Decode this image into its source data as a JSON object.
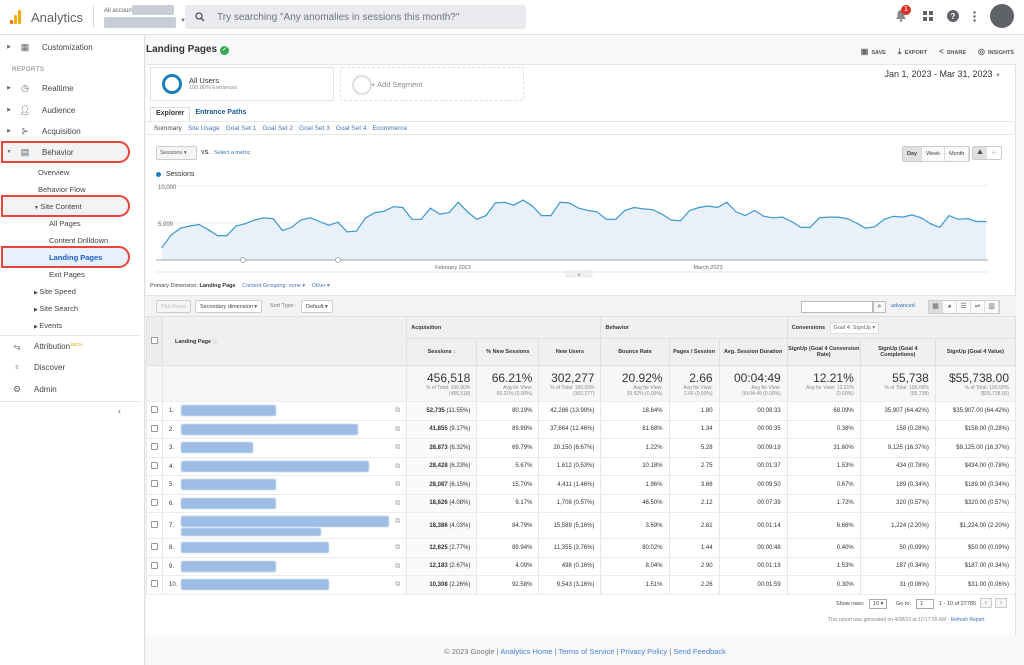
{
  "app": {
    "title": "Analytics",
    "all_accounts": "All accounts >",
    "search_placeholder": "Try searching \"Any anomalies in sessions this month?\"",
    "notification_count": "1"
  },
  "sidebar": {
    "customization": "Customization",
    "reports_label": "REPORTS",
    "items": [
      "Realtime",
      "Audience",
      "Acquisition",
      "Behavior"
    ],
    "behavior_sub": [
      "Overview",
      "Behavior Flow"
    ],
    "site_content": "Site Content",
    "site_content_sub": [
      "All Pages",
      "Content Drilldown",
      "Landing Pages",
      "Exit Pages"
    ],
    "more_sub": [
      "Site Speed",
      "Site Search",
      "Events"
    ],
    "attribution": "Attribution",
    "beta": "BETA",
    "discover": "Discover",
    "admin": "Admin"
  },
  "header": {
    "title": "Landing Pages",
    "save": "SAVE",
    "export": "EXPORT",
    "share": "SHARE",
    "insights": "INSIGHTS",
    "date_range": "Jan 1, 2023 - Mar 31, 2023"
  },
  "segments": {
    "name": "All Users",
    "sub": "100.00% Entrances",
    "add": "+ Add Segment"
  },
  "tabs": [
    "Explorer",
    "Entrance Paths"
  ],
  "subtabs": [
    "Summary",
    "Site Usage",
    "Goal Set 1",
    "Goal Set 2",
    "Goal Set 3",
    "Goal Set 4",
    "Ecommerce"
  ],
  "chart_controls": {
    "metric": "Sessions",
    "vs": "VS.",
    "select_metric": "Select a metric",
    "granularity": [
      "Day",
      "Week",
      "Month"
    ]
  },
  "chart_data": {
    "type": "area",
    "series": [
      {
        "name": "Sessions",
        "color": "#1a7fbf",
        "values": [
          1700,
          3400,
          4300,
          4600,
          4800,
          4100,
          3300,
          3300,
          4600,
          4900,
          5400,
          5700,
          5600,
          4000,
          4400,
          5400,
          5700,
          5200,
          4700,
          5100,
          3800,
          3900,
          5700,
          6400,
          6600,
          7200,
          7100,
          5500,
          5500,
          7000,
          6200,
          6400,
          7800,
          6500,
          5500,
          6000,
          7700,
          7800,
          7400,
          8100,
          7300,
          6000,
          6000,
          7800,
          7700,
          7000,
          6700,
          6500,
          5500,
          5500,
          6700,
          7100,
          6900,
          6800,
          6200,
          5400,
          5300,
          6700,
          7100,
          7300,
          7100,
          7800,
          6500,
          6000,
          6700,
          5900,
          5700,
          5800,
          5200,
          4400,
          4400,
          5700,
          5800,
          5800,
          5600,
          5000,
          4300,
          4500,
          5500,
          5900,
          5800,
          6100,
          5700,
          4900,
          4400,
          6000,
          5500,
          5600,
          5200,
          5200
        ]
      }
    ],
    "yticks": [
      "10,000",
      "5,000"
    ],
    "ylim": [
      0,
      11000
    ],
    "xlabels": [
      "February 2023",
      "March 2023"
    ],
    "grid": true
  },
  "dimension": {
    "primary_label": "Primary Dimension:",
    "primary": "Landing Page",
    "grouping": "Content Grouping: none ▾",
    "other": "Other ▾"
  },
  "toolbar": {
    "plot_rows": "Plot Rows",
    "secondary": "Secondary dimension ▾",
    "sort_type": "Sort Type:",
    "sort_value": "Default ▾",
    "advanced": "advanced"
  },
  "table": {
    "landing_col": "Landing Page",
    "groups": [
      "Acquisition",
      "Behavior",
      "Conversions"
    ],
    "goal_select": "Goal 4: SignUp ▾",
    "columns": [
      "Sessions",
      "% New Sessions",
      "New Users",
      "Bounce Rate",
      "Pages / Session",
      "Avg. Session Duration",
      "SignUp (Goal 4 Conversion Rate)",
      "SignUp (Goal 4 Completions)",
      "SignUp (Goal 4 Value)"
    ],
    "totals": [
      {
        "v": "456,518",
        "s1": "% of Total: 100.00%",
        "s2": "(456,518)"
      },
      {
        "v": "66.21%",
        "s1": "Avg for View:",
        "s2": "66.21% (0.00%)"
      },
      {
        "v": "302,277",
        "s1": "% of Total: 100.00%",
        "s2": "(302,277)"
      },
      {
        "v": "20.92%",
        "s1": "Avg for View:",
        "s2": "20.92% (0.00%)"
      },
      {
        "v": "2.66",
        "s1": "Avg for View:",
        "s2": "2.66 (0.00%)"
      },
      {
        "v": "00:04:49",
        "s1": "Avg for View:",
        "s2": "00:04:49 (0.00%)"
      },
      {
        "v": "12.21%",
        "s1": "Avg for View: 12.21%",
        "s2": "(0.00%)"
      },
      {
        "v": "55,738",
        "s1": "% of Total: 100.00%",
        "s2": "(55,738)"
      },
      {
        "v": "$55,738.00",
        "s1": "% of Total: 100.00%",
        "s2": "($55,738.00)"
      }
    ],
    "rows": [
      {
        "n": "1.",
        "s": "52,735",
        "sp": "(11.55%)",
        "ns": "80.19%",
        "nu": "42,286",
        "nup": "(13.99%)",
        "br": "18.84%",
        "ps": "1.80",
        "d": "00:08:33",
        "cr": "68.09%",
        "c": "35,907",
        "cp": "(64.42%)",
        "gv": "$35,907.00",
        "gvp": "(64.42%)"
      },
      {
        "n": "2.",
        "s": "41,855",
        "sp": "(9.17%)",
        "ns": "89.99%",
        "nu": "37,664",
        "nup": "(12.46%)",
        "br": "81.68%",
        "ps": "1.34",
        "d": "00:00:35",
        "cr": "0.38%",
        "c": "158",
        "cp": "(0.28%)",
        "gv": "$158.00",
        "gvp": "(0.28%)"
      },
      {
        "n": "3.",
        "s": "28,873",
        "sp": "(6.32%)",
        "ns": "69.79%",
        "nu": "20,150",
        "nup": "(6.67%)",
        "br": "1.22%",
        "ps": "5.28",
        "d": "00:09:19",
        "cr": "31.60%",
        "c": "9,125",
        "cp": "(16.37%)",
        "gv": "$9,125.00",
        "gvp": "(16.37%)"
      },
      {
        "n": "4.",
        "s": "28,428",
        "sp": "(6.23%)",
        "ns": "5.67%",
        "nu": "1,612",
        "nup": "(0.53%)",
        "br": "10.18%",
        "ps": "2.75",
        "d": "00:01:37",
        "cr": "1.53%",
        "c": "434",
        "cp": "(0.78%)",
        "gv": "$434.00",
        "gvp": "(0.78%)"
      },
      {
        "n": "5.",
        "s": "28,087",
        "sp": "(6.15%)",
        "ns": "15.70%",
        "nu": "4,411",
        "nup": "(1.46%)",
        "br": "1.96%",
        "ps": "3.66",
        "d": "00:09:50",
        "cr": "0.67%",
        "c": "189",
        "cp": "(0.34%)",
        "gv": "$189.00",
        "gvp": "(0.34%)"
      },
      {
        "n": "6.",
        "s": "18,626",
        "sp": "(4.08%)",
        "ns": "9.17%",
        "nu": "1,708",
        "nup": "(0.57%)",
        "br": "46.50%",
        "ps": "2.12",
        "d": "00:07:39",
        "cr": "1.72%",
        "c": "320",
        "cp": "(0.57%)",
        "gv": "$320.00",
        "gvp": "(0.57%)"
      },
      {
        "n": "7.",
        "s": "18,386",
        "sp": "(4.03%)",
        "ns": "84.79%",
        "nu": "15,589",
        "nup": "(5.16%)",
        "br": "3.69%",
        "ps": "2.81",
        "d": "00:01:14",
        "cr": "6.66%",
        "c": "1,224",
        "cp": "(2.20%)",
        "gv": "$1,224.00",
        "gvp": "(2.20%)"
      },
      {
        "n": "8.",
        "s": "12,625",
        "sp": "(2.77%)",
        "ns": "89.94%",
        "nu": "11,355",
        "nup": "(3.76%)",
        "br": "80.02%",
        "ps": "1.44",
        "d": "00:00:48",
        "cr": "0.40%",
        "c": "50",
        "cp": "(0.09%)",
        "gv": "$50.00",
        "gvp": "(0.09%)"
      },
      {
        "n": "9.",
        "s": "12,183",
        "sp": "(2.67%)",
        "ns": "4.09%",
        "nu": "498",
        "nup": "(0.16%)",
        "br": "8.04%",
        "ps": "2.90",
        "d": "00:01:19",
        "cr": "1.53%",
        "c": "187",
        "cp": "(0.34%)",
        "gv": "$187.00",
        "gvp": "(0.34%)"
      },
      {
        "n": "10.",
        "s": "10,308",
        "sp": "(2.26%)",
        "ns": "92.58%",
        "nu": "9,543",
        "nup": "(3.16%)",
        "br": "1.51%",
        "ps": "2.26",
        "d": "00:01:59",
        "cr": "0.30%",
        "c": "31",
        "cp": "(0.06%)",
        "gv": "$31.00",
        "gvp": "(0.06%)"
      }
    ]
  },
  "pager": {
    "show_rows": "Show rows:",
    "rows_value": "10",
    "goto": "Go to:",
    "goto_value": "1",
    "range": "1 - 10 of 27785",
    "generated": "This report was generated on 4/28/23 at 10:17:55 AM -",
    "refresh": "Refresh Report"
  },
  "footer": {
    "copyright": "© 2023 Google |",
    "links": [
      "Analytics Home",
      "Terms of Service",
      "Privacy Policy",
      "Send Feedback"
    ]
  }
}
